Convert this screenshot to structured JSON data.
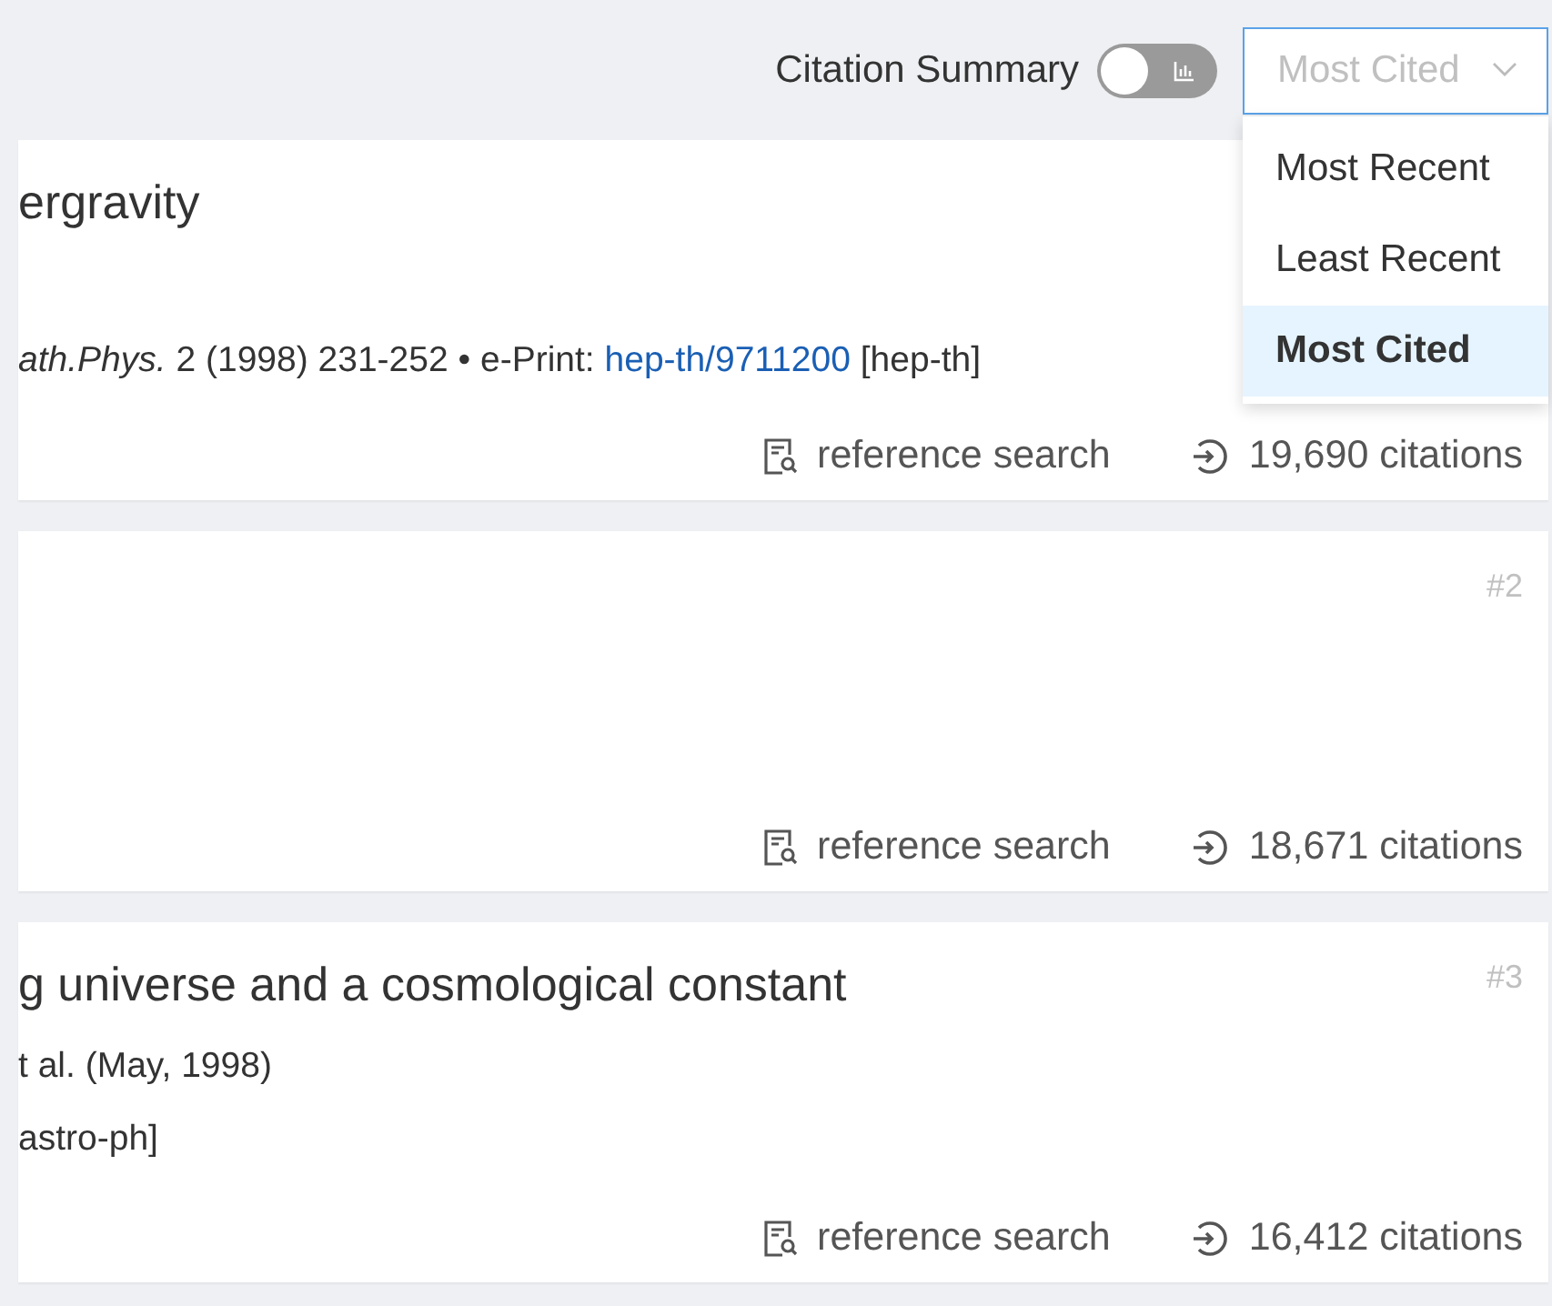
{
  "toolbar": {
    "citation_summary": {
      "label": "Citation Summary",
      "on": false
    },
    "sort": {
      "value": "Most Cited",
      "open": true,
      "options": [
        {
          "label": "Most Recent",
          "selected": false
        },
        {
          "label": "Least Recent",
          "selected": false
        },
        {
          "label": "Most Cited",
          "selected": true
        }
      ]
    }
  },
  "results": [
    {
      "title": "ergravity",
      "publication": "*ath.Phys.* 2 (1998) 231-252 • e-Print: ",
      "eprint_link": "hep-th/9711200",
      "eprint_category": " [hep-th]",
      "reference_search": "reference search",
      "citations": "19,690 citations"
    },
    {
      "number": "#2",
      "reference_search": "reference search",
      "citations": "18,671 citations"
    },
    {
      "number": "#3",
      "title": "g universe and a cosmological constant",
      "authors": "t al. (May, 1998)",
      "publication": "astro-ph]",
      "reference_search": "reference search",
      "citations": "16,412 citations"
    }
  ]
}
